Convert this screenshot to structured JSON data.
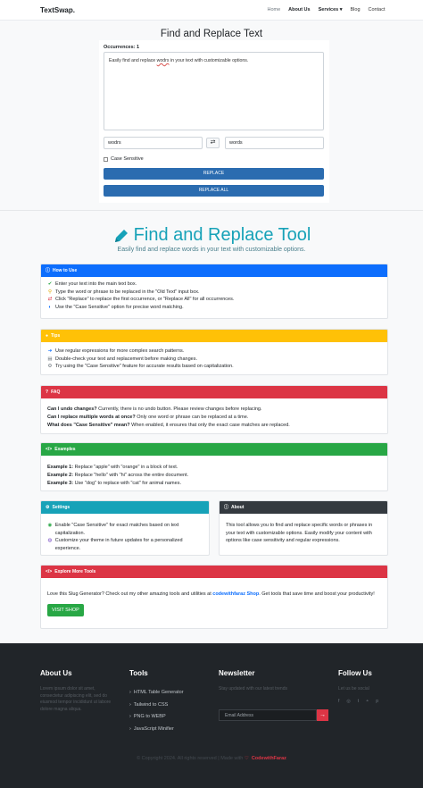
{
  "nav": {
    "brand": "TextSwap.",
    "links": [
      "Home",
      "About Us",
      "Services ▾",
      "Blog",
      "Contact"
    ]
  },
  "tool": {
    "title": "Find and Replace Text",
    "occurrences": "Occurrences: 1",
    "text_before": "Easily find and replace ",
    "text_error_word": "wodrs",
    "text_after": " in your text with customizable options.",
    "find_value": "wodrs",
    "replace_value": "words",
    "swap_icon": "⇄",
    "case_label": "Case Sensitive",
    "replace_btn": "REPLACE",
    "replace_all_btn": "REPLACE ALL"
  },
  "hero": {
    "title": "Find and Replace Tool",
    "subtitle": "Easily find and replace words in your text with customizable options."
  },
  "how": {
    "header": "How to Use",
    "items": [
      "Enter your text into the main text box.",
      "Type the word or phrase to be replaced in the \"Old Text\" input box.",
      "Click \"Replace\" to replace the first occurrence, or \"Replace All\" for all occurrences.",
      "Use the \"Case Sensitive\" option for precise word matching."
    ]
  },
  "tips": {
    "header": "Tips",
    "items": [
      "Use regular expressions for more complex search patterns.",
      "Double-check your text and replacement before making changes.",
      "Try using the \"Case Sensitive\" feature for accurate results based on capitalization."
    ]
  },
  "faq": {
    "header": "FAQ",
    "items": [
      {
        "q": "Can I undo changes?",
        "a": " Currently, there is no undo button. Please review changes before replacing."
      },
      {
        "q": "Can I replace multiple words at once?",
        "a": " Only one word or phrase can be replaced at a time."
      },
      {
        "q": "What does \"Case Sensitive\" mean?",
        "a": " When enabled, it ensures that only the exact case matches are replaced."
      }
    ]
  },
  "examples": {
    "header": "Examples",
    "items": [
      {
        "k": "Example 1:",
        "v": " Replace \"apple\" with \"orange\" in a block of text."
      },
      {
        "k": "Example 2:",
        "v": " Replace \"hello\" with \"hi\" across the entire document."
      },
      {
        "k": "Example 3:",
        "v": " Use \"dog\" to replace with \"cat\" for animal names."
      }
    ]
  },
  "settings": {
    "header": "Settings",
    "items": [
      "Enable \"Case Sensitive\" for exact matches based on text capitalization.",
      "Customize your theme in future updates for a personalized experience."
    ]
  },
  "about": {
    "header": "About",
    "text": "This tool allows you to find and replace specific words or phrases in your text with customizable options. Easily modify your content with options like case sensitivity and regular expressions."
  },
  "explore": {
    "header": "Explore More Tools",
    "text_before": "Love this Slug Generator? Check out my other amazing tools and utilities at ",
    "link": "codewithfaraz Shop",
    "text_after": ". Get tools that save time and boost your productivity!",
    "button": "VISIT SHOP"
  },
  "footer": {
    "about_title": "About Us",
    "about_text": "Lorem ipsum dolor sit amet, consectetur adipiscing elit, sed do eiusmod tempor incididunt ut labore dolore magna aliqua.",
    "services_title": "Tools",
    "services": [
      "HTML Table Generator",
      "Tailwind to CSS",
      "PNG to WEBP",
      "JavaScript Minifier"
    ],
    "newsletter_title": "Newsletter",
    "newsletter_text": "Stay updated with our latest trends",
    "email_placeholder": "Email Address",
    "follow_title": "Follow Us",
    "follow_text": "Let us be social",
    "copyright": "© Copyright 2024. All rights reserved | Made with",
    "copyright_brand": "CodewithFaraz"
  },
  "colors": {
    "how": "#0d6efd",
    "tips": "#ffc107",
    "faq": "#dc3545",
    "examples": "#28a745",
    "settings": "#17a2b8",
    "about": "#343a40",
    "explore": "#dc3545",
    "hero": "#17a2b8"
  }
}
